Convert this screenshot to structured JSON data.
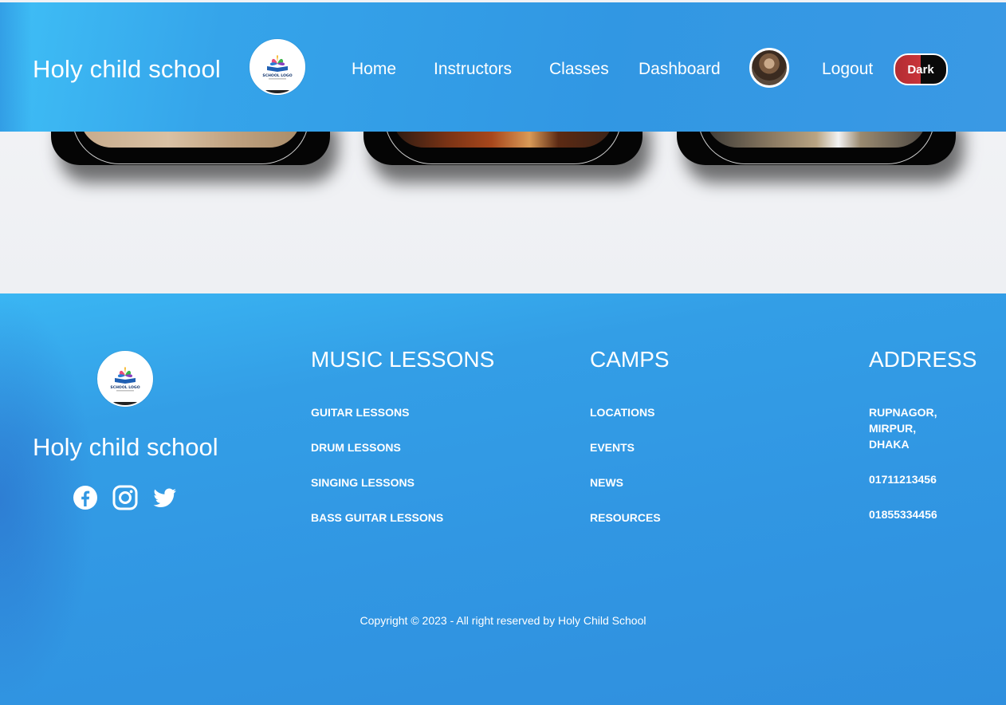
{
  "header": {
    "brand": "Holy child school",
    "logo_text": "SCHOOL LOGO",
    "nav": [
      "Home",
      "Instructors",
      "Classes",
      "Dashboard"
    ],
    "logout": "Logout",
    "theme_toggle": "Dark"
  },
  "colors": {
    "primary": "#3197e3",
    "primary_light": "#3fbff6",
    "toggle_red": "#c9343a",
    "toggle_dark": "#0a0a0a"
  },
  "footer": {
    "brand": "Holy child school",
    "logo_text": "SCHOOL LOGO",
    "social_icons": [
      "facebook-icon",
      "instagram-icon",
      "twitter-icon"
    ],
    "music": {
      "title": "MUSIC LESSONS",
      "items": [
        "GUITAR LESSONS",
        "DRUM LESSONS",
        "SINGING LESSONS",
        "BASS GUITAR LESSONS"
      ]
    },
    "camps": {
      "title": "CAMPS",
      "items": [
        "LOCATIONS",
        "EVENTS",
        "NEWS",
        "RESOURCES"
      ]
    },
    "address": {
      "title": "ADDRESS",
      "lines": [
        "RUPNAGOR,",
        "MIRPUR,",
        "DHAKA"
      ],
      "phones": [
        "01711213456",
        "01855334456"
      ]
    },
    "copyright": "Copyright © 2023 - All right reserved by Holy Child School"
  }
}
